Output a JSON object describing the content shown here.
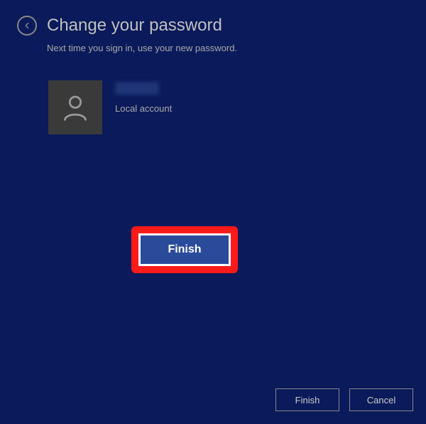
{
  "header": {
    "title": "Change your password",
    "subtitle": "Next time you sign in, use your new password."
  },
  "account": {
    "type_label": "Local account"
  },
  "buttons": {
    "finish_main": "Finish",
    "finish_footer": "Finish",
    "cancel_footer": "Cancel"
  }
}
